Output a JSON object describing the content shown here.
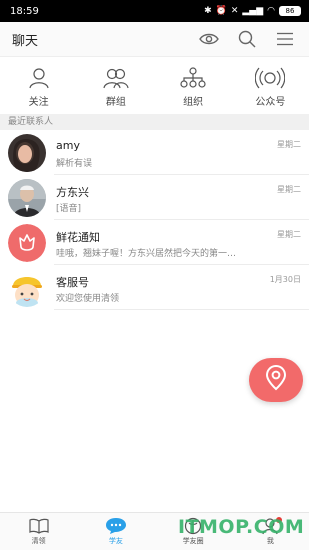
{
  "status": {
    "time": "18:59",
    "battery": "86"
  },
  "header": {
    "title": "聊天",
    "icons": [
      "eye-icon",
      "search-icon",
      "menu-icon"
    ]
  },
  "quick_actions": [
    {
      "label": "关注",
      "icon": "person-icon"
    },
    {
      "label": "群组",
      "icon": "group-icon"
    },
    {
      "label": "组织",
      "icon": "org-chart-icon"
    },
    {
      "label": "公众号",
      "icon": "broadcast-icon"
    }
  ],
  "recent": {
    "header": "最近联系人",
    "items": [
      {
        "name": "amy",
        "message": "解析有误",
        "time": "星期二",
        "avatar": "photo-avatar"
      },
      {
        "name": "方东兴",
        "message": "[语音]",
        "time": "星期二",
        "avatar": "photo-avatar"
      },
      {
        "name": "鲜花通知",
        "message": "哇哦，翘妹子喔！方东兴居然把今天的第一…",
        "time": "星期二",
        "avatar": "flower-icon"
      },
      {
        "name": "客服号",
        "message": "欢迎您使用清领",
        "time": "1月30日",
        "avatar": "service-avatar"
      }
    ]
  },
  "fab": {
    "icon": "location-pin-icon"
  },
  "bottom_nav": [
    {
      "label": "清领",
      "icon": "book-icon",
      "active": false
    },
    {
      "label": "学友",
      "icon": "chat-bubble-icon",
      "active": true
    },
    {
      "label": "学友圈",
      "icon": "circle-icon",
      "active": false
    },
    {
      "label": "我",
      "icon": "person-icon",
      "active": false
    }
  ],
  "watermark": "ITMOP.COM",
  "colors": {
    "accent": "#2aa0e8",
    "fab": "#f26a6a",
    "watermark": "#36b36a"
  }
}
